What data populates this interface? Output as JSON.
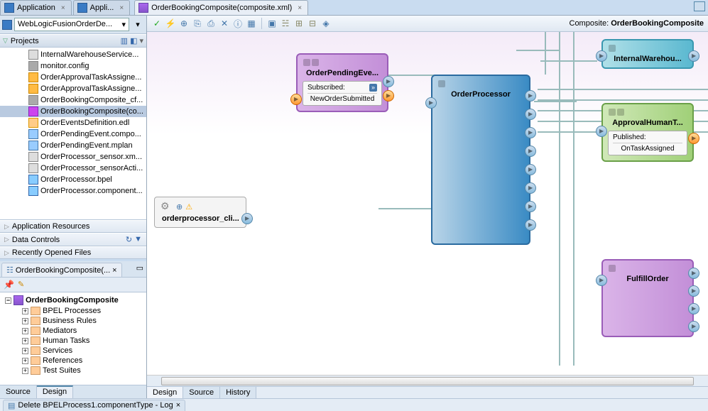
{
  "top_tabs": {
    "app": "Application",
    "appli": "Appli...",
    "composite": "OrderBookingComposite(composite.xml)"
  },
  "left": {
    "dropdown": "WebLogicFusionOrderDe...",
    "projects_label": "Projects",
    "tree": [
      "InternalWarehouseService...",
      "monitor.config",
      "OrderApprovalTaskAssigne...",
      "OrderApprovalTaskAssigne...",
      "OrderBookingComposite_cf...",
      "OrderBookingComposite(co...",
      "OrderEventsDefinition.edl",
      "OrderPendingEvent.compo...",
      "OrderPendingEvent.mplan",
      "OrderProcessor_sensor.xm...",
      "OrderProcessor_sensorActi...",
      "OrderProcessor.bpel",
      "OrderProcessor.component..."
    ],
    "accordion": {
      "app_resources": "Application Resources",
      "data_controls": "Data Controls",
      "recent": "Recently Opened Files"
    },
    "structure": {
      "tab": "OrderBookingComposite(...",
      "root": "OrderBookingComposite",
      "children": [
        "BPEL Processes",
        "Business Rules",
        "Mediators",
        "Human Tasks",
        "Services",
        "References",
        "Test Suites"
      ]
    },
    "bottom_tabs": {
      "source": "Source",
      "design": "Design"
    }
  },
  "editor": {
    "composite_label_prefix": "Composite: ",
    "composite_name": "OrderBookingComposite",
    "components": {
      "order_pending": {
        "title": "OrderPendingEve...",
        "inner_hdr": "Subscribed:",
        "inner_val": "NewOrderSubmitted"
      },
      "order_processor": {
        "title": "OrderProcessor"
      },
      "internal_wh": {
        "title": "InternalWarehou..."
      },
      "approval": {
        "title": "ApprovalHumanT...",
        "inner_hdr": "Published:",
        "inner_val": "OnTaskAssigned"
      },
      "fulfill": {
        "title": "FulfillOrder"
      },
      "client": {
        "title": "orderprocessor_cli..."
      }
    },
    "bottom_tabs": {
      "design": "Design",
      "source": "Source",
      "history": "History"
    }
  },
  "log": {
    "label": "Delete BPELProcess1.componentType - Log"
  }
}
